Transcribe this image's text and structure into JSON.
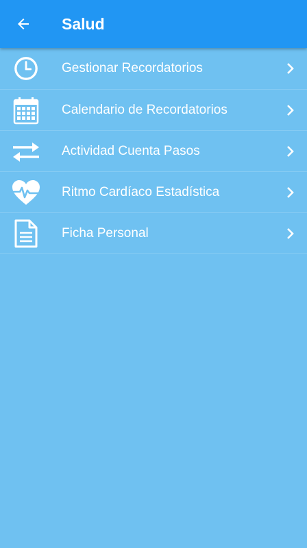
{
  "appbar": {
    "title": "Salud",
    "back_icon": "arrow-left-icon"
  },
  "colors": {
    "appbar": "#2196f3",
    "background": "#6fc1f1",
    "text": "#ffffff"
  },
  "menu": {
    "items": [
      {
        "label": "Gestionar Recordatorios",
        "icon": "clock-icon"
      },
      {
        "label": "Calendario de Recordatorios",
        "icon": "calendar-icon"
      },
      {
        "label": "Actividad Cuenta Pasos",
        "icon": "swap-arrows-icon"
      },
      {
        "label": "Ritmo Cardíaco Estadística",
        "icon": "heartbeat-icon"
      },
      {
        "label": "Ficha Personal",
        "icon": "document-icon"
      }
    ],
    "chevron_icon": "chevron-right-icon"
  }
}
